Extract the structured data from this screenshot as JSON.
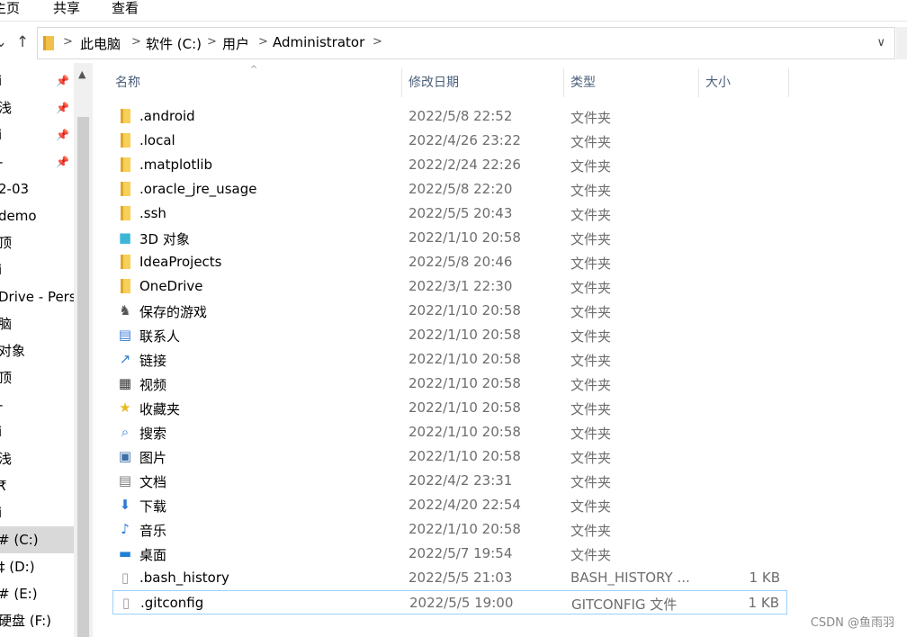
{
  "ribbon": {
    "tabs": [
      "主页",
      "共享",
      "查看"
    ]
  },
  "address": {
    "crumbs": [
      "此电脑",
      "软件 (C:)",
      "用户",
      "Administrator"
    ]
  },
  "sidebar": {
    "items": [
      {
        "label": "i",
        "pinned": true
      },
      {
        "label": "浅",
        "pinned": true
      },
      {
        "label": "i",
        "pinned": true
      },
      {
        "label": "-",
        "pinned": true
      },
      {
        "label": "2-03",
        "pinned": false
      },
      {
        "label": "demo",
        "pinned": false
      },
      {
        "label": "顶",
        "pinned": false
      },
      {
        "label": "i",
        "pinned": false
      },
      {
        "label": "Drive - Perso",
        "pinned": false
      },
      {
        "label": "脑",
        "pinned": false
      },
      {
        "label": "对象",
        "pinned": false
      },
      {
        "label": "顶",
        "pinned": false
      },
      {
        "label": "-",
        "pinned": false
      },
      {
        "label": "i",
        "pinned": false
      },
      {
        "label": "浅",
        "pinned": false
      },
      {
        "label": "₹",
        "pinned": false
      },
      {
        "label": "i",
        "pinned": false
      },
      {
        "label": "# (C:)",
        "pinned": false,
        "selected": true
      },
      {
        "label": "‡ (D:)",
        "pinned": false
      },
      {
        "label": "# (E:)",
        "pinned": false
      },
      {
        "label": "硬盘 (F:)",
        "pinned": false
      }
    ]
  },
  "columns": {
    "name": "名称",
    "date": "修改日期",
    "type": "类型",
    "size": "大小"
  },
  "files": [
    {
      "name": ".android",
      "date": "2022/5/8 22:52",
      "type": "文件夹",
      "size": "",
      "icon": "folder-icon"
    },
    {
      "name": ".local",
      "date": "2022/4/26 23:22",
      "type": "文件夹",
      "size": "",
      "icon": "folder-icon"
    },
    {
      "name": ".matplotlib",
      "date": "2022/2/24 22:26",
      "type": "文件夹",
      "size": "",
      "icon": "folder-icon"
    },
    {
      "name": ".oracle_jre_usage",
      "date": "2022/5/8 22:20",
      "type": "文件夹",
      "size": "",
      "icon": "folder-icon"
    },
    {
      "name": ".ssh",
      "date": "2022/5/5 20:43",
      "type": "文件夹",
      "size": "",
      "icon": "folder-icon"
    },
    {
      "name": "3D 对象",
      "date": "2022/1/10 20:58",
      "type": "文件夹",
      "size": "",
      "icon": "3d-objects-icon"
    },
    {
      "name": "IdeaProjects",
      "date": "2022/5/8 20:46",
      "type": "文件夹",
      "size": "",
      "icon": "folder-icon"
    },
    {
      "name": "OneDrive",
      "date": "2022/3/1 22:30",
      "type": "文件夹",
      "size": "",
      "icon": "folder-icon"
    },
    {
      "name": "保存的游戏",
      "date": "2022/1/10 20:58",
      "type": "文件夹",
      "size": "",
      "icon": "saved-games-icon"
    },
    {
      "name": "联系人",
      "date": "2022/1/10 20:58",
      "type": "文件夹",
      "size": "",
      "icon": "contacts-icon"
    },
    {
      "name": "链接",
      "date": "2022/1/10 20:58",
      "type": "文件夹",
      "size": "",
      "icon": "links-icon"
    },
    {
      "name": "视频",
      "date": "2022/1/10 20:58",
      "type": "文件夹",
      "size": "",
      "icon": "videos-icon"
    },
    {
      "name": "收藏夹",
      "date": "2022/1/10 20:58",
      "type": "文件夹",
      "size": "",
      "icon": "favorites-icon"
    },
    {
      "name": "搜索",
      "date": "2022/1/10 20:58",
      "type": "文件夹",
      "size": "",
      "icon": "searches-icon"
    },
    {
      "name": "图片",
      "date": "2022/1/10 20:58",
      "type": "文件夹",
      "size": "",
      "icon": "pictures-icon"
    },
    {
      "name": "文档",
      "date": "2022/4/2 23:31",
      "type": "文件夹",
      "size": "",
      "icon": "documents-icon"
    },
    {
      "name": "下载",
      "date": "2022/4/20 22:54",
      "type": "文件夹",
      "size": "",
      "icon": "downloads-icon"
    },
    {
      "name": "音乐",
      "date": "2022/1/10 20:58",
      "type": "文件夹",
      "size": "",
      "icon": "music-icon"
    },
    {
      "name": "桌面",
      "date": "2022/5/7 19:54",
      "type": "文件夹",
      "size": "",
      "icon": "desktop-icon"
    },
    {
      "name": ".bash_history",
      "date": "2022/5/5 21:03",
      "type": "BASH_HISTORY ...",
      "size": "1 KB",
      "icon": "file-icon"
    },
    {
      "name": ".gitconfig",
      "date": "2022/5/5 19:00",
      "type": "GITCONFIG 文件",
      "size": "1 KB",
      "icon": "file-icon",
      "focused": true
    }
  ],
  "watermark": "CSDN @鱼雨羽"
}
